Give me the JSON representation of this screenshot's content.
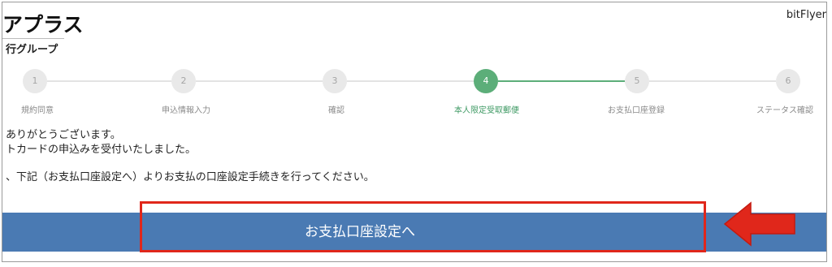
{
  "header": {
    "brand": "アプラス",
    "brand_sub": "行グループ",
    "partner": "bitFlyer"
  },
  "stepper": {
    "current": 4,
    "steps": [
      {
        "number": "1",
        "label": "規約同意"
      },
      {
        "number": "2",
        "label": "申込情報入力"
      },
      {
        "number": "3",
        "label": "確認"
      },
      {
        "number": "4",
        "label": "本人限定受取郵便"
      },
      {
        "number": "5",
        "label": "お支払口座登録"
      },
      {
        "number": "6",
        "label": "ステータス確認"
      }
    ]
  },
  "message": {
    "line1": "ありがとうございます。",
    "line2": "トカードの申込みを受付いたしました。",
    "line3": "、下記（お支払口座設定へ）よりお支払の口座設定手続きを行ってください。"
  },
  "cta": {
    "label": "お支払口座設定へ"
  },
  "colors": {
    "active_step": "#5cae79",
    "button": "#4a7ab3",
    "annotation_red": "#e0271b"
  }
}
